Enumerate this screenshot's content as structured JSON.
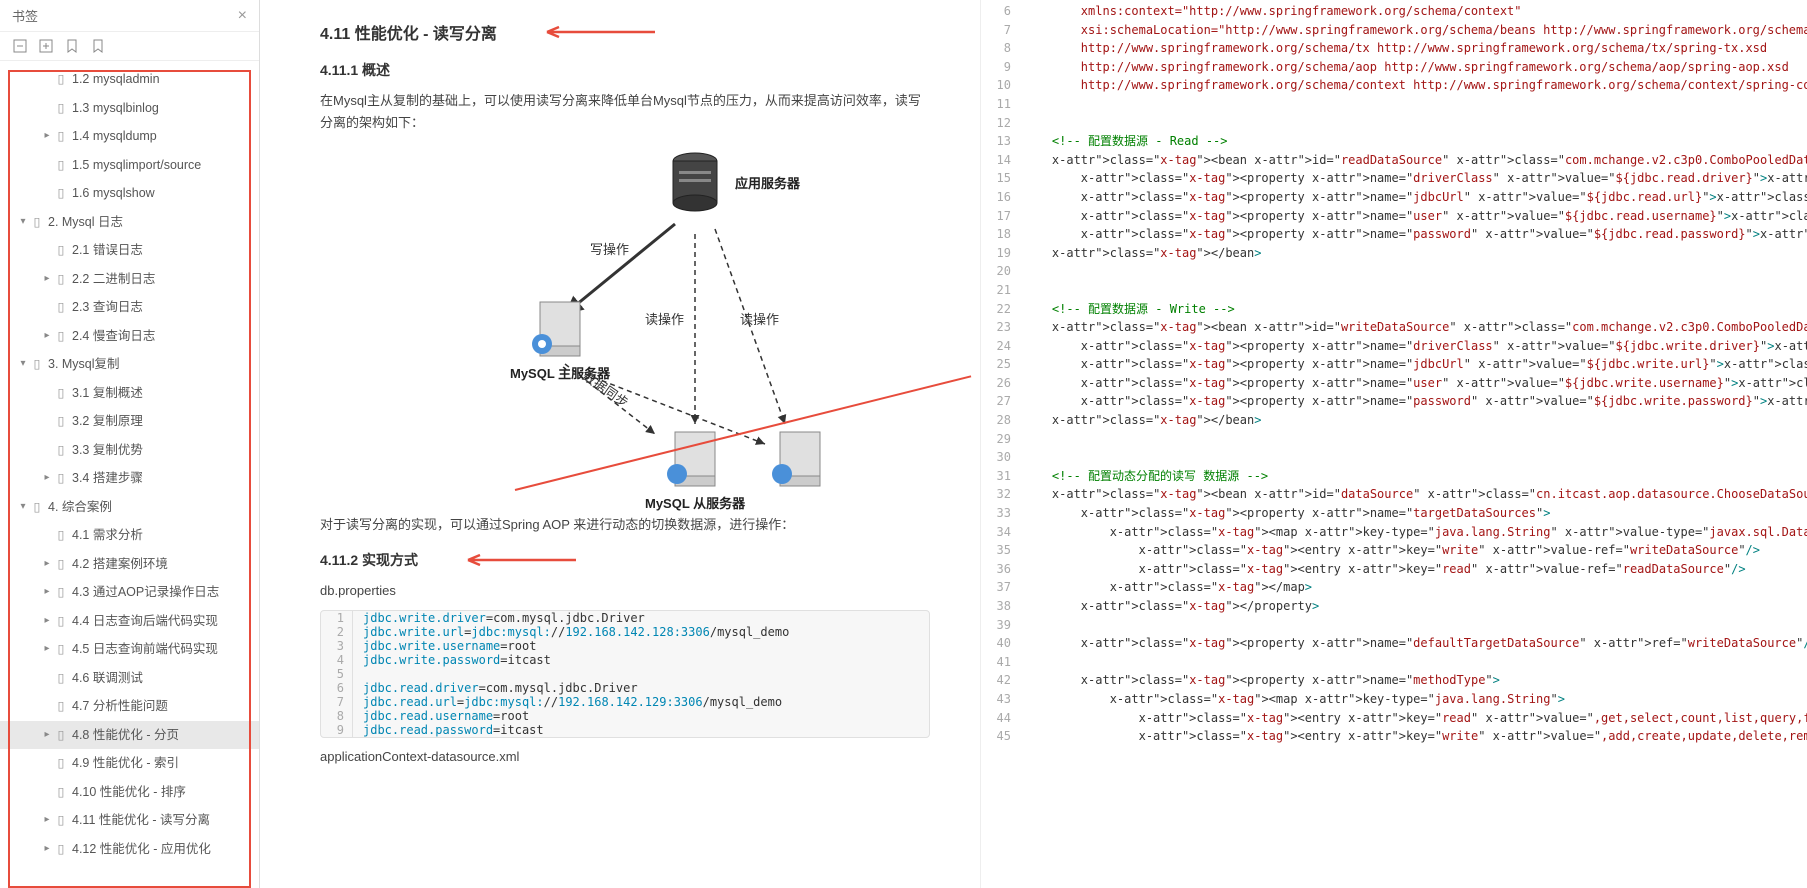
{
  "sidebar": {
    "title": "书签",
    "items": [
      {
        "label": "1.2 mysqladmin",
        "indent": 2,
        "caret": ""
      },
      {
        "label": "1.3 mysqlbinlog",
        "indent": 2,
        "caret": ""
      },
      {
        "label": "1.4 mysqldump",
        "indent": 2,
        "caret": "▸"
      },
      {
        "label": "1.5 mysqlimport/source",
        "indent": 2,
        "caret": ""
      },
      {
        "label": "1.6 mysqlshow",
        "indent": 2,
        "caret": ""
      },
      {
        "label": "2. Mysql 日志",
        "indent": 1,
        "caret": "▾"
      },
      {
        "label": "2.1 错误日志",
        "indent": 2,
        "caret": ""
      },
      {
        "label": "2.2 二进制日志",
        "indent": 2,
        "caret": "▸"
      },
      {
        "label": "2.3 查询日志",
        "indent": 2,
        "caret": ""
      },
      {
        "label": "2.4 慢查询日志",
        "indent": 2,
        "caret": "▸"
      },
      {
        "label": "3. Mysql复制",
        "indent": 1,
        "caret": "▾"
      },
      {
        "label": "3.1 复制概述",
        "indent": 2,
        "caret": ""
      },
      {
        "label": "3.2 复制原理",
        "indent": 2,
        "caret": ""
      },
      {
        "label": "3.3 复制优势",
        "indent": 2,
        "caret": ""
      },
      {
        "label": "3.4 搭建步骤",
        "indent": 2,
        "caret": "▸"
      },
      {
        "label": "4. 综合案例",
        "indent": 1,
        "caret": "▾"
      },
      {
        "label": "4.1 需求分析",
        "indent": 2,
        "caret": ""
      },
      {
        "label": "4.2 搭建案例环境",
        "indent": 2,
        "caret": "▸"
      },
      {
        "label": "4.3 通过AOP记录操作日志",
        "indent": 2,
        "caret": "▸"
      },
      {
        "label": "4.4 日志查询后端代码实现",
        "indent": 2,
        "caret": "▸"
      },
      {
        "label": "4.5 日志查询前端代码实现",
        "indent": 2,
        "caret": "▸"
      },
      {
        "label": "4.6 联调测试",
        "indent": 2,
        "caret": ""
      },
      {
        "label": "4.7 分析性能问题",
        "indent": 2,
        "caret": ""
      },
      {
        "label": "4.8 性能优化 - 分页",
        "indent": 2,
        "caret": "▸",
        "selected": true
      },
      {
        "label": "4.9 性能优化 - 索引",
        "indent": 2,
        "caret": ""
      },
      {
        "label": "4.10 性能优化 - 排序",
        "indent": 2,
        "caret": ""
      },
      {
        "label": "4.11 性能优化 - 读写分离",
        "indent": 2,
        "caret": "▸"
      },
      {
        "label": "4.12 性能优化 - 应用优化",
        "indent": 2,
        "caret": "▸"
      }
    ]
  },
  "content": {
    "h1": "4.11 性能优化 - 读写分离",
    "h2a": "4.11.1 概述",
    "p1": "在Mysql主从复制的基础上，可以使用读写分离来降低单台Mysql节点的压力，从而来提高访问效率，读写分离的架构如下：",
    "diagram": {
      "app": "应用服务器",
      "master": "MySQL\n主服务器",
      "slave": "MySQL\n从服务器",
      "write": "写操作",
      "read1": "读操作",
      "read2": "读操作",
      "sync": "数据同步"
    },
    "p2": "对于读写分离的实现，可以通过Spring AOP 来进行动态的切换数据源，进行操作：",
    "h2b": "4.11.2 实现方式",
    "file1": "db.properties",
    "code1": [
      "jdbc.write.driver=com.mysql.jdbc.Driver",
      "jdbc.write.url=jdbc:mysql://192.168.142.128:3306/mysql_demo",
      "jdbc.write.username=root",
      "jdbc.write.password=itcast",
      "",
      "jdbc.read.driver=com.mysql.jdbc.Driver",
      "jdbc.read.url=jdbc:mysql://192.168.142.129:3306/mysql_demo",
      "jdbc.read.username=root",
      "jdbc.read.password=itcast"
    ],
    "file2": "applicationContext-datasource.xml"
  },
  "code_right": [
    {
      "n": 6,
      "t": "        xmlns:context=\"http://www.springframework.org/schema/context\""
    },
    {
      "n": 7,
      "t": "        xsi:schemaLocation=\"http://www.springframework.org/schema/beans http://www.springframework.org/schema/beans/spring-beans.xsd"
    },
    {
      "n": 8,
      "t": "        http://www.springframework.org/schema/tx http://www.springframework.org/schema/tx/spring-tx.xsd"
    },
    {
      "n": 9,
      "t": "        http://www.springframework.org/schema/aop http://www.springframework.org/schema/aop/spring-aop.xsd"
    },
    {
      "n": 10,
      "t": "        http://www.springframework.org/schema/context http://www.springframework.org/schema/context/spring-context.xsd\">"
    },
    {
      "n": 11,
      "t": ""
    },
    {
      "n": 12,
      "t": ""
    },
    {
      "n": 13,
      "t": "    <!-- 配置数据源 - Read -->",
      "cmt": true
    },
    {
      "n": 14,
      "t": "    <bean id=\"readDataSource\" class=\"com.mchange.v2.c3p0.ComboPooledDataSource\" destroy-method=\"close\"  lazy-init=\"true\">"
    },
    {
      "n": 15,
      "t": "        <property name=\"driverClass\" value=\"${jdbc.read.driver}\"></property>"
    },
    {
      "n": 16,
      "t": "        <property name=\"jdbcUrl\" value=\"${jdbc.read.url}\"></property>"
    },
    {
      "n": 17,
      "t": "        <property name=\"user\" value=\"${jdbc.read.username}\"></property>"
    },
    {
      "n": 18,
      "t": "        <property name=\"password\" value=\"${jdbc.read.password}\"></property>"
    },
    {
      "n": 19,
      "t": "    </bean>"
    },
    {
      "n": 20,
      "t": ""
    },
    {
      "n": 21,
      "t": ""
    },
    {
      "n": 22,
      "t": "    <!-- 配置数据源 - Write -->",
      "cmt": true
    },
    {
      "n": 23,
      "t": "    <bean id=\"writeDataSource\" class=\"com.mchange.v2.c3p0.ComboPooledDataSource\"  destroy-method=\"close\"  lazy-init=\"true\">"
    },
    {
      "n": 24,
      "t": "        <property name=\"driverClass\" value=\"${jdbc.write.driver}\"></property>"
    },
    {
      "n": 25,
      "t": "        <property name=\"jdbcUrl\" value=\"${jdbc.write.url}\"></property>"
    },
    {
      "n": 26,
      "t": "        <property name=\"user\" value=\"${jdbc.write.username}\"></property>"
    },
    {
      "n": 27,
      "t": "        <property name=\"password\" value=\"${jdbc.write.password}\"></property>"
    },
    {
      "n": 28,
      "t": "    </bean>"
    },
    {
      "n": 29,
      "t": ""
    },
    {
      "n": 30,
      "t": ""
    },
    {
      "n": 31,
      "t": "    <!-- 配置动态分配的读写 数据源 -->",
      "cmt": true
    },
    {
      "n": 32,
      "t": "    <bean id=\"dataSource\" class=\"cn.itcast.aop.datasource.ChooseDataSource\" lazy-init=\"true\">"
    },
    {
      "n": 33,
      "t": "        <property name=\"targetDataSources\">"
    },
    {
      "n": 34,
      "t": "            <map key-type=\"java.lang.String\" value-type=\"javax.sql.DataSource\">"
    },
    {
      "n": 35,
      "t": "                <entry key=\"write\" value-ref=\"writeDataSource\"/>"
    },
    {
      "n": 36,
      "t": "                <entry key=\"read\" value-ref=\"readDataSource\"/>"
    },
    {
      "n": 37,
      "t": "            </map>"
    },
    {
      "n": 38,
      "t": "        </property>"
    },
    {
      "n": 39,
      "t": ""
    },
    {
      "n": 40,
      "t": "        <property name=\"defaultTargetDataSource\" ref=\"writeDataSource\"/>"
    },
    {
      "n": 41,
      "t": ""
    },
    {
      "n": 42,
      "t": "        <property name=\"methodType\">"
    },
    {
      "n": 43,
      "t": "            <map key-type=\"java.lang.String\">"
    },
    {
      "n": 44,
      "t": "                <entry key=\"read\" value=\",get,select,count,list,query,find\"/>"
    },
    {
      "n": 45,
      "t": "                <entry key=\"write\" value=\",add,create,update,delete,remove,insert\"/>"
    }
  ]
}
